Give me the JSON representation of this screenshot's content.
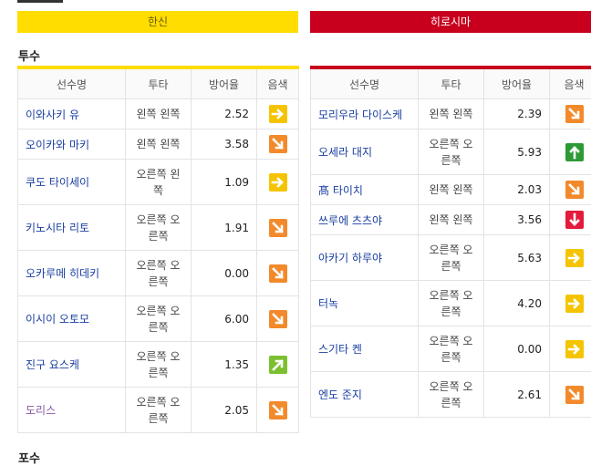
{
  "teams": {
    "away": "한신",
    "home": "히로시마"
  },
  "sections": {
    "pitcher": "투수",
    "catcher": "포수"
  },
  "headers": [
    "선수명",
    "투타",
    "방어율",
    "음색"
  ],
  "away_pitchers": [
    {
      "name": "이와사키 유",
      "hand": "왼쪽 왼쪽",
      "era": "2.52",
      "icon": "arrow-right-icon"
    },
    {
      "name": "오이카와 마키",
      "hand": "왼쪽 왼쪽",
      "era": "3.58",
      "icon": "arrow-down-right-icon"
    },
    {
      "name": "쿠도 타이세이",
      "hand": "오른쪽 왼쪽",
      "era": "1.09",
      "icon": "arrow-right-icon"
    },
    {
      "name": "키노시타 리토",
      "hand": "오른쪽 오른쪽",
      "era": "1.91",
      "icon": "arrow-down-right-icon"
    },
    {
      "name": "오카루메 히데키",
      "hand": "오른쪽 오른쪽",
      "era": "0.00",
      "icon": "arrow-down-right-icon"
    },
    {
      "name": "이시이 오토모",
      "hand": "오른쪽 오른쪽",
      "era": "6.00",
      "icon": "arrow-down-right-icon"
    },
    {
      "name": "진구 요스케",
      "hand": "오른쪽 오른쪽",
      "era": "1.35",
      "icon": "arrow-up-right-icon"
    },
    {
      "name": "도리스",
      "hand": "오른쪽 오른쪽",
      "era": "2.05",
      "icon": "arrow-down-right-icon"
    }
  ],
  "home_pitchers": [
    {
      "name": "모리우라 다이스케",
      "hand": "왼쪽 왼쪽",
      "era": "2.39",
      "icon": "arrow-down-right-icon"
    },
    {
      "name": "오세라 대지",
      "hand": "오른쪽 오른쪽",
      "era": "5.93",
      "icon": "arrow-up-icon"
    },
    {
      "name": "髙 타이치",
      "hand": "왼쪽 왼쪽",
      "era": "2.03",
      "icon": "arrow-down-right-icon"
    },
    {
      "name": "쓰루에 츠츠야",
      "hand": "왼쪽 왼쪽",
      "era": "3.56",
      "icon": "arrow-down-icon"
    },
    {
      "name": "아카기 하루야",
      "hand": "오른쪽 오른쪽",
      "era": "5.63",
      "icon": "arrow-right-icon"
    },
    {
      "name": "터녹",
      "hand": "오른쪽 오른쪽",
      "era": "4.20",
      "icon": "arrow-right-icon"
    },
    {
      "name": "스기타 켄",
      "hand": "오른쪽 오른쪽",
      "era": "0.00",
      "icon": "arrow-right-icon"
    },
    {
      "name": "엔도 준지",
      "hand": "오른쪽 오른쪽",
      "era": "2.61",
      "icon": "arrow-down-right-icon"
    }
  ],
  "colors": {
    "away_accent": "#ffdd00",
    "home_accent": "#c8001e",
    "name_link": "#1a3fa0"
  }
}
